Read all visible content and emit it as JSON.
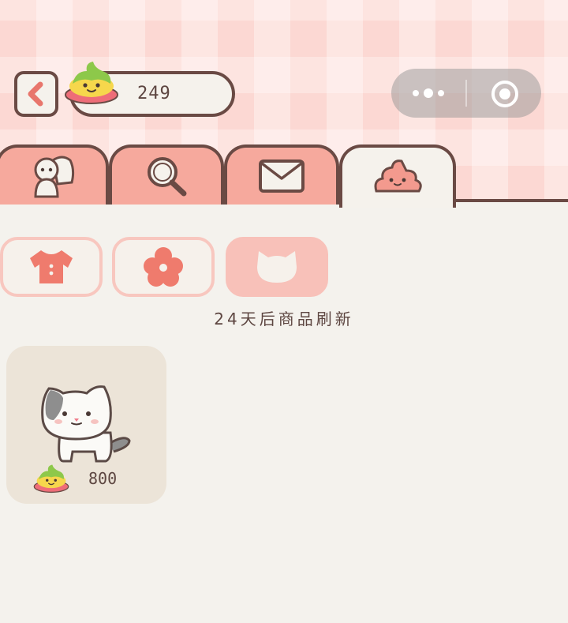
{
  "header": {
    "coins": "249",
    "back_icon": "chevron-left-icon",
    "currency_icon": "poop-coin-icon"
  },
  "capsule": {
    "more_icon": "more-dots-icon",
    "close_icon": "target-circle-icon"
  },
  "tabs": [
    {
      "icon": "friends-icon",
      "active": false
    },
    {
      "icon": "search-icon",
      "active": false
    },
    {
      "icon": "mail-icon",
      "active": false
    },
    {
      "icon": "poop-shop-icon",
      "active": true
    }
  ],
  "subtabs": [
    {
      "icon": "shirt-icon",
      "active": false
    },
    {
      "icon": "flower-icon",
      "active": false
    },
    {
      "icon": "cat-face-icon",
      "active": true
    }
  ],
  "shop": {
    "refresh_text": "24天后商品刷新",
    "items": [
      {
        "icon": "calico-cat-icon",
        "price": "800"
      }
    ]
  },
  "colors": {
    "accent": "#f6a99d",
    "outline": "#6a4a44",
    "background": "#f4f2ed"
  }
}
